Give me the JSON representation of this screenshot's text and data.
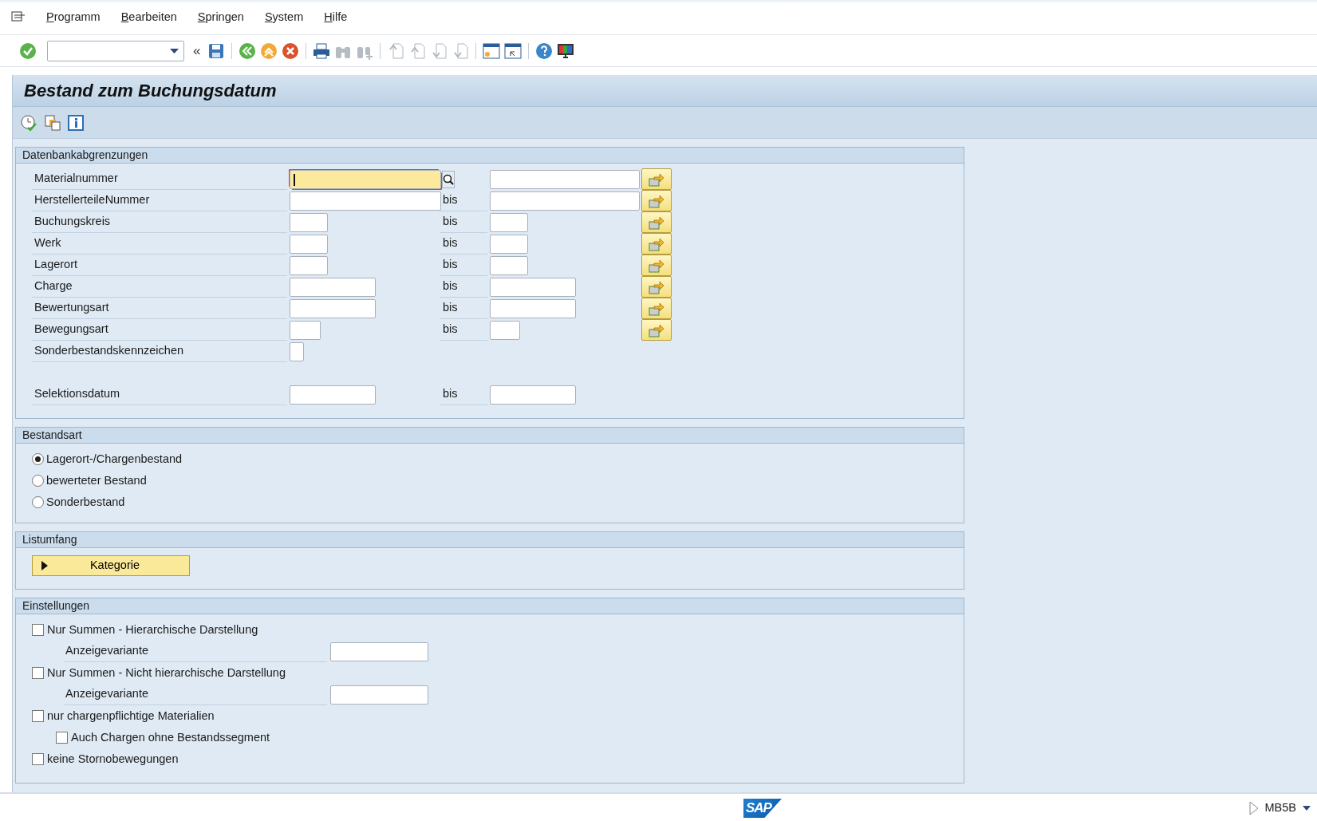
{
  "menu": [
    {
      "label": "Programm"
    },
    {
      "label": "Bearbeiten"
    },
    {
      "label": "Springen"
    },
    {
      "label": "System"
    },
    {
      "label": "Hilfe"
    }
  ],
  "toolbar": {
    "collapse": "«"
  },
  "title": "Bestand zum Buchungsdatum",
  "sections": [
    {
      "kind": "selection",
      "title": "Datenbankabgrenzungen",
      "rows": [
        {
          "label": "Materialnummer",
          "focused": true,
          "search_help": true,
          "multiple_selection": true,
          "range": true
        },
        {
          "label": "HerstellerteileNummer",
          "bis": "bis",
          "focused": false,
          "search_help": false,
          "multiple_selection": true,
          "range": true
        },
        {
          "label": "Buchungskreis",
          "bis": "bis",
          "focused": false,
          "search_help": false,
          "multiple_selection": true,
          "range": true
        },
        {
          "label": "Werk",
          "bis": "bis",
          "focused": false,
          "search_help": false,
          "multiple_selection": true,
          "range": true
        },
        {
          "label": "Lagerort",
          "bis": "bis",
          "focused": false,
          "search_help": false,
          "multiple_selection": true,
          "range": true
        },
        {
          "label": "Charge",
          "bis": "bis",
          "focused": false,
          "search_help": false,
          "multiple_selection": true,
          "range": true
        },
        {
          "label": "Bewertungsart",
          "bis": "bis",
          "focused": false,
          "search_help": false,
          "multiple_selection": true,
          "range": true
        },
        {
          "label": "Bewegungsart",
          "bis": "bis",
          "focused": false,
          "search_help": false,
          "multiple_selection": true,
          "range": true
        },
        {
          "label": "Sonderbestandskennzeichen",
          "focused": false,
          "search_help": false,
          "multiple_selection": false,
          "range": false
        },
        {
          "label": "Selektionsdatum",
          "bis": "bis",
          "focused": false,
          "search_help": false,
          "multiple_selection": false,
          "range": true
        }
      ]
    },
    {
      "kind": "radios",
      "title": "Bestandsart",
      "options": [
        {
          "label": "Lagerort-/Chargenbestand",
          "selected": true
        },
        {
          "label": "bewerteter Bestand",
          "selected": false
        },
        {
          "label": "Sonderbestand",
          "selected": false
        }
      ]
    },
    {
      "kind": "expander",
      "title": "Listumfang",
      "button": {
        "label": "Kategorie",
        "expanded": false
      }
    },
    {
      "kind": "checks",
      "title": "Einstellungen",
      "items": [
        {
          "kind": "checkbox",
          "label": "Nur Summen - Hierarchische Darstellung",
          "checked": false,
          "children": [
            {
              "kind": "field",
              "label": "Anzeigevariante"
            }
          ]
        },
        {
          "kind": "checkbox",
          "label": "Nur Summen - Nicht hierarchische Darstellung",
          "checked": false,
          "children": [
            {
              "kind": "field",
              "label": "Anzeigevariante"
            }
          ]
        },
        {
          "kind": "checkbox",
          "label": "nur chargenpflichtige Materialien",
          "checked": false,
          "children": [
            {
              "kind": "checkbox",
              "label": "Auch Chargen ohne Bestandssegment",
              "checked": false
            }
          ]
        },
        {
          "kind": "checkbox",
          "label": "keine Stornobewegungen",
          "checked": false
        }
      ]
    }
  ],
  "status_bar": {
    "logo": "SAP",
    "transaction": "MB5B"
  }
}
